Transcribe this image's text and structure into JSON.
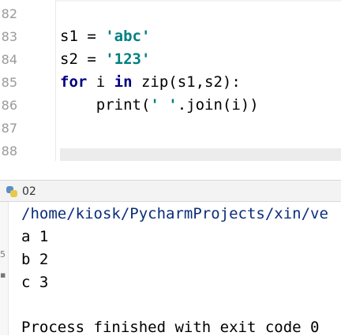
{
  "editor": {
    "line_numbers": [
      "82",
      "83",
      "84",
      "85",
      "86",
      "87",
      "88"
    ],
    "lines": [
      {
        "parts": []
      },
      {
        "parts": [
          {
            "t": "s1 = ",
            "c": ""
          },
          {
            "t": "'abc'",
            "c": "str"
          }
        ]
      },
      {
        "parts": [
          {
            "t": "s2 = ",
            "c": ""
          },
          {
            "t": "'123'",
            "c": "str"
          }
        ]
      },
      {
        "parts": [
          {
            "t": "for",
            "c": "kw"
          },
          {
            "t": " i ",
            "c": ""
          },
          {
            "t": "in",
            "c": "kw"
          },
          {
            "t": " zip(s1,s2):",
            "c": ""
          }
        ]
      },
      {
        "parts": [
          {
            "t": "    print(",
            "c": ""
          },
          {
            "t": "' '",
            "c": "str"
          },
          {
            "t": ".join(i))",
            "c": ""
          }
        ]
      },
      {
        "parts": []
      },
      {
        "parts": []
      }
    ]
  },
  "run_panel": {
    "tab_label": "02",
    "tab_icon": "python-icon",
    "tool_marks": [
      "5",
      "▪"
    ]
  },
  "console": {
    "path_line": "/home/kiosk/PycharmProjects/xin/ve",
    "output_lines": [
      "a 1",
      "b 2",
      "c 3"
    ],
    "exit_line": "Process finished with exit code 0"
  },
  "colors": {
    "keyword": "#000080",
    "string": "#008080",
    "line_number": "#9a9a9a",
    "path": "#0a2d7a"
  }
}
